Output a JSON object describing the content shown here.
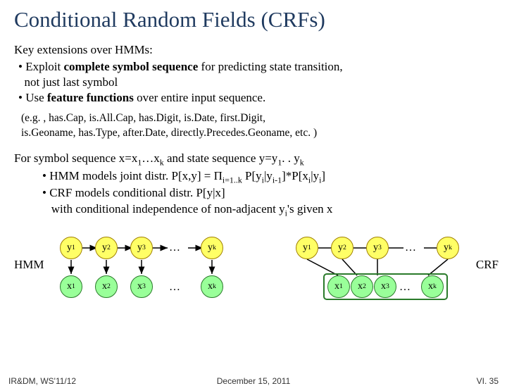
{
  "title": "Conditional Random Fields (CRFs)",
  "intro": "Key extensions over HMMs:",
  "bullet1_pre": "• Exploit ",
  "bullet1_bold": "complete symbol sequence",
  "bullet1_post": " for predicting state transition,",
  "bullet1_line2": "  not just last symbol",
  "bullet2_pre": "• Use ",
  "bullet2_bold": "feature functions",
  "bullet2_post": " over entire input sequence.",
  "examples_l1": "(e.g. , has.Cap, is.All.Cap, has.Digit, is.Date, first.Digit,",
  "examples_l2": "is.Geoname, has.Type, after.Date, directly.Precedes.Geoname, etc. )",
  "formula_intro_a": "For symbol sequence x=x",
  "formula_intro_b": "…x",
  "formula_intro_c": " and state sequence y=y",
  "formula_intro_d": ". . y",
  "hmm_line_a": "• HMM models joint distr. P[x,y] = Π",
  "hmm_line_sub": "i=1..k",
  "hmm_line_b": " P[y",
  "hmm_line_c": "|y",
  "hmm_line_d": "]*P[x",
  "hmm_line_e": "|y",
  "hmm_line_f": "]",
  "crf_line": "• CRF models conditional distr. P[y|x]",
  "crf_line2_a": "   with conditional independence of non-adjacent y",
  "crf_line2_b": "'s given x",
  "hmm_label": "HMM",
  "crf_label": "CRF",
  "y1": "y",
  "y2": "y",
  "y3": "y",
  "yk": "y",
  "x1": "x",
  "x2": "x",
  "x3": "x",
  "xk": "x",
  "s1": "1",
  "s2": "2",
  "s3": "3",
  "sk": "k",
  "si": "i",
  "sim1": "i-1",
  "dots": "…",
  "footer_left": "IR&DM, WS'11/12",
  "footer_center": "December 15, 2011",
  "footer_right": "VI. 35"
}
